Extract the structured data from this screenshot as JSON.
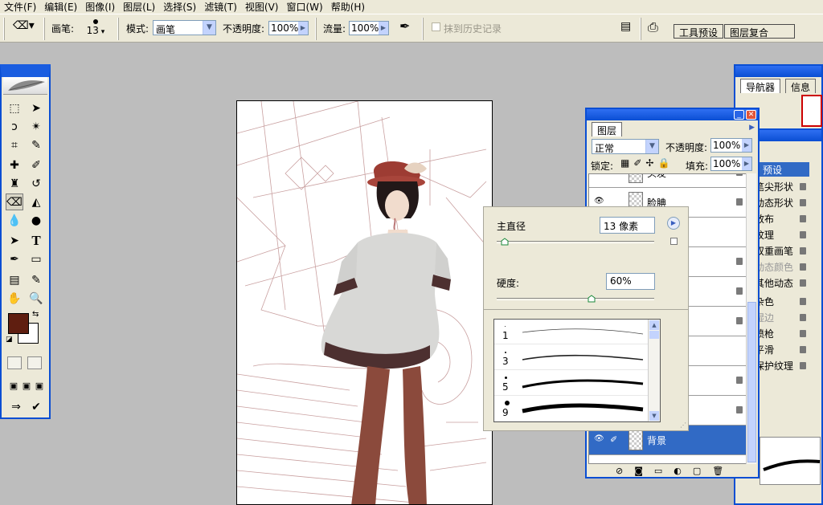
{
  "menu": [
    "文件(F)",
    "编辑(E)",
    "图像(I)",
    "图层(L)",
    "选择(S)",
    "滤镜(T)",
    "视图(V)",
    "窗口(W)",
    "帮助(H)"
  ],
  "options_bar": {
    "brush_label": "画笔:",
    "brush_size": "13",
    "mode_label": "模式:",
    "mode_value": "画笔",
    "opacity_label": "不透明度:",
    "opacity_value": "100%",
    "flow_label": "流量:",
    "flow_value": "100%",
    "erase_history_label": "抹到历史记录",
    "palette_tabs": [
      "工具预设",
      "图层复合"
    ]
  },
  "brush_popup": {
    "master_diameter_label": "主直径",
    "master_diameter_value": "13 像素",
    "hardness_label": "硬度:",
    "hardness_value": "60%",
    "diameter_fraction": 0.05,
    "hardness_fraction": 0.6,
    "brushes": [
      {
        "size": "1"
      },
      {
        "size": "3"
      },
      {
        "size": "5"
      },
      {
        "size": "9"
      }
    ]
  },
  "navigator": {
    "tabs": [
      "导航器",
      "信息"
    ]
  },
  "layers": {
    "tab": "图层",
    "blend_mode": "正常",
    "opacity_label": "不透明度:",
    "opacity_value": "100%",
    "lock_label": "锁定:",
    "fill_label": "填充:",
    "fill_value": "100%",
    "visible_layers": [
      {
        "name": "头发"
      },
      {
        "name": "脸腆"
      },
      {
        "name": ""
      },
      {
        "name": ""
      },
      {
        "name": ""
      },
      {
        "name": ""
      },
      {
        "name": ""
      },
      {
        "name": ""
      },
      {
        "name": "背景",
        "selected": true
      }
    ]
  },
  "brushes_palette": {
    "tab": "预设",
    "options": [
      "笔尖形状",
      "动态形状",
      "散布",
      "纹理",
      "双重画笔",
      "动态颜色",
      "其他动态",
      "杂色",
      "湿边",
      "喷枪",
      "平滑",
      "保护纹理"
    ]
  },
  "colors": {
    "foreground": "#5f1e10",
    "background": "#ffffff",
    "title_blue": "#0a4ed3",
    "selection": "#316ac5"
  }
}
